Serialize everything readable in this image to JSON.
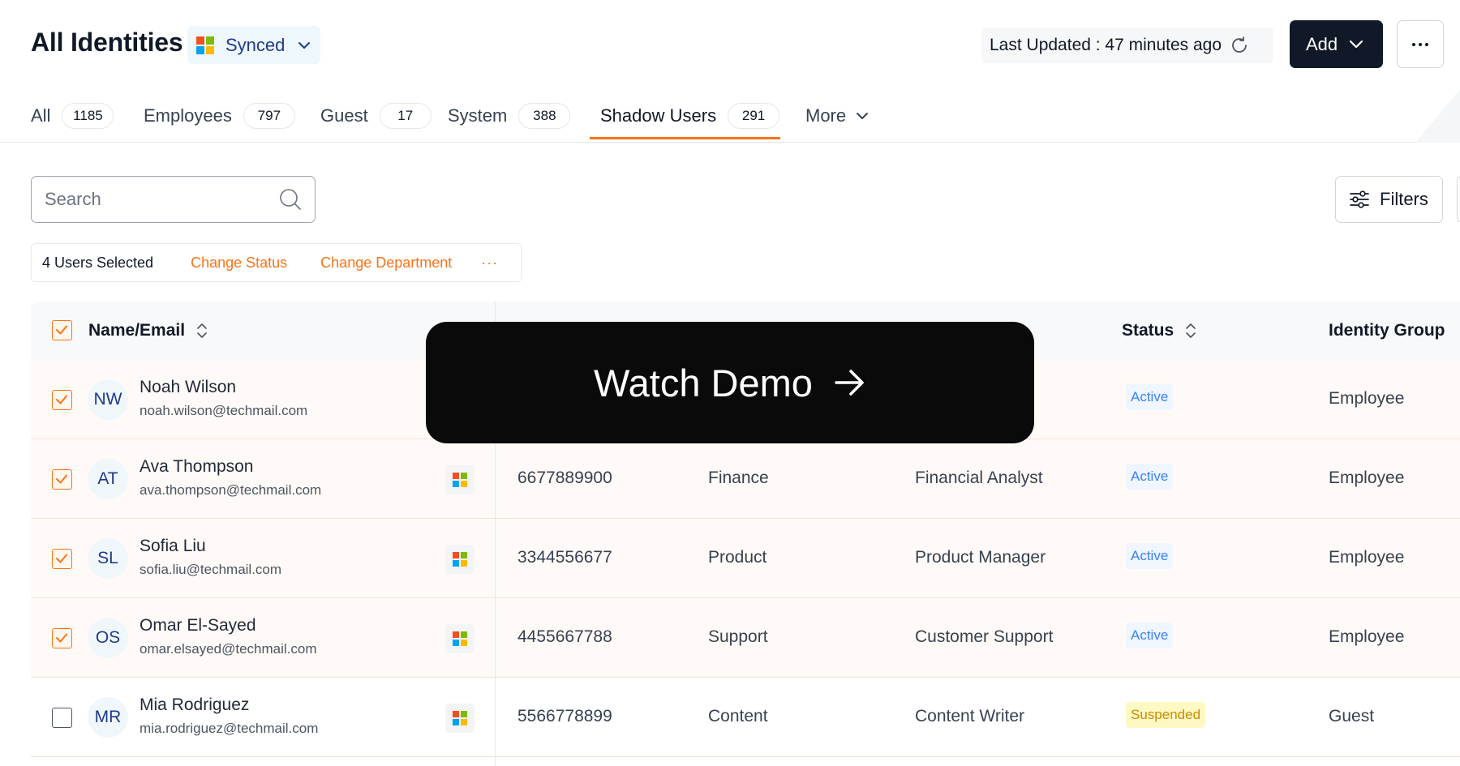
{
  "header": {
    "title": "All Identities",
    "sync_label": "Synced",
    "last_updated": "Last Updated : 47 minutes ago",
    "add_label": "Add",
    "more_label": "···"
  },
  "tabs": [
    {
      "label": "All",
      "count": "1185"
    },
    {
      "label": "Employees",
      "count": "797"
    },
    {
      "label": "Guest",
      "count": "17"
    },
    {
      "label": "System",
      "count": "388"
    },
    {
      "label": "Shadow Users",
      "count": "291"
    },
    {
      "label": "More"
    }
  ],
  "active_tab": "Shadow Users",
  "search": {
    "placeholder": "Search"
  },
  "filters_label": "Filters",
  "selection": {
    "count_label": "4 Users Selected",
    "actions": [
      "Change Status",
      "Change Department",
      "···"
    ]
  },
  "table": {
    "headers": {
      "name": "Name/Email",
      "status": "Status",
      "group": "Identity Group"
    },
    "rows": [
      {
        "initials": "NW",
        "name": "Noah Wilson",
        "email": "noah.wilson@techmail.com",
        "phone": "",
        "department": "",
        "role": "",
        "status": "Active",
        "group": "Employee",
        "selected": true
      },
      {
        "initials": "AT",
        "name": "Ava Thompson",
        "email": "ava.thompson@techmail.com",
        "phone": "6677889900",
        "department": "Finance",
        "role": "Financial Analyst",
        "status": "Active",
        "group": "Employee",
        "selected": true
      },
      {
        "initials": "SL",
        "name": "Sofia Liu",
        "email": "sofia.liu@techmail.com",
        "phone": "3344556677",
        "department": "Product",
        "role": "Product Manager",
        "status": "Active",
        "group": "Employee",
        "selected": true
      },
      {
        "initials": "OS",
        "name": "Omar El-Sayed",
        "email": "omar.elsayed@techmail.com",
        "phone": "4455667788",
        "department": "Support",
        "role": "Customer Support",
        "status": "Active",
        "group": "Employee",
        "selected": true
      },
      {
        "initials": "MR",
        "name": "Mia Rodriguez",
        "email": "mia.rodriguez@techmail.com",
        "phone": "5566778899",
        "department": "Content",
        "role": "Content Writer",
        "status": "Suspended",
        "group": "Guest",
        "selected": false
      }
    ]
  },
  "overlay": {
    "label": "Watch Demo"
  },
  "colors": {
    "accent": "#f97316",
    "dark": "#111827",
    "status_active": "#3b82f6",
    "status_suspended": "#ca8a04",
    "ms_red": "#f25022",
    "ms_green": "#7fba00",
    "ms_blue": "#00a4ef",
    "ms_yellow": "#ffb900"
  }
}
